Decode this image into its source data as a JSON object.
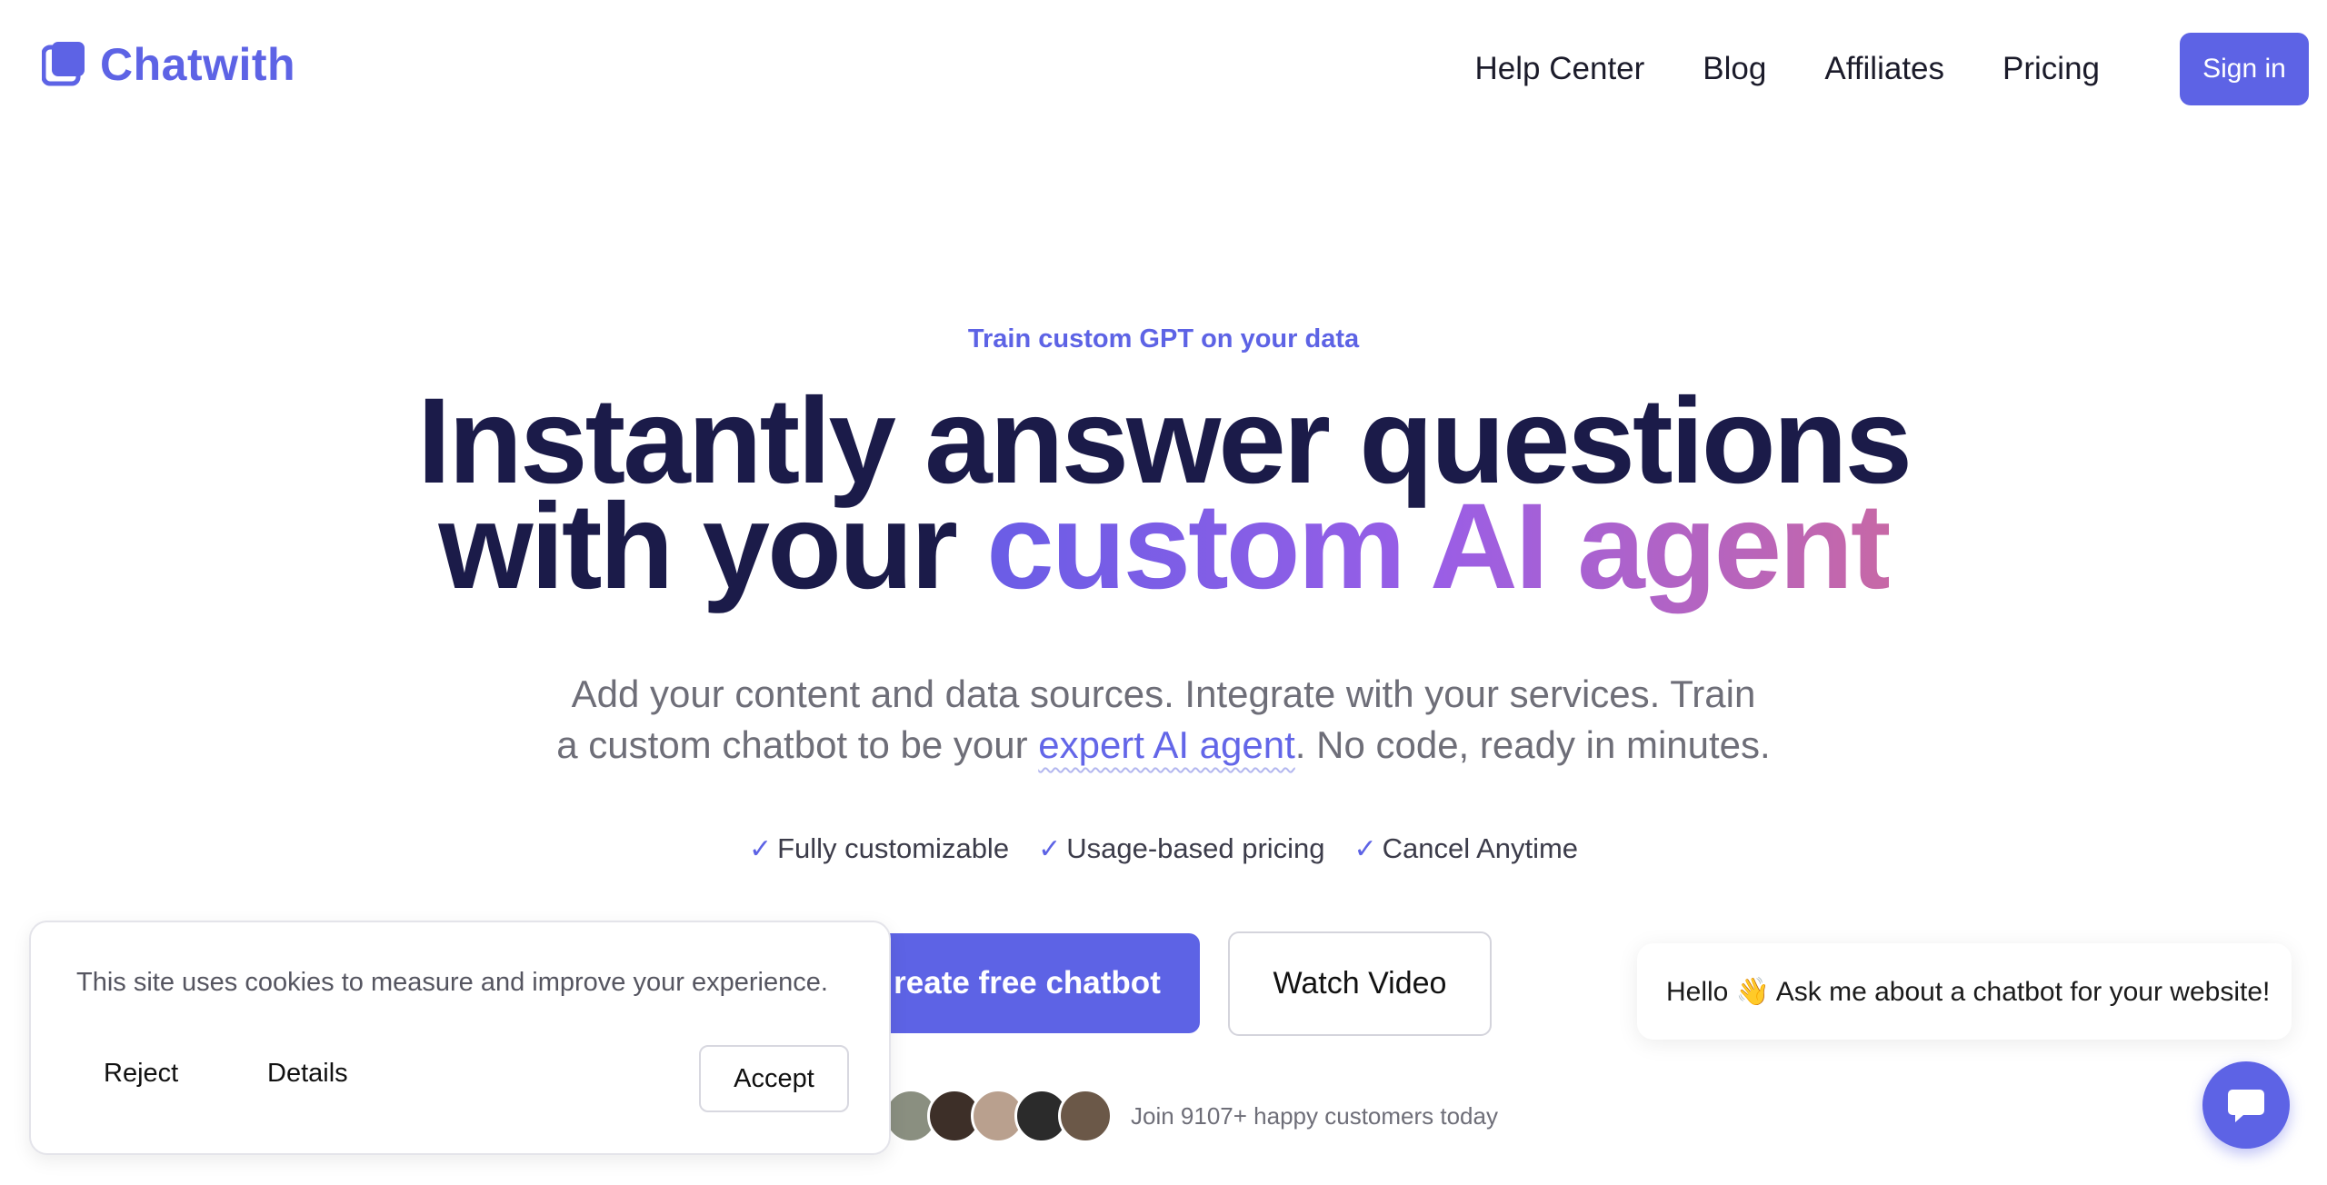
{
  "colors": {
    "brand": "#5d63e5",
    "heading": "#1b1b49",
    "body_text": "#6e6e78"
  },
  "header": {
    "logo_text": "Chatwith",
    "nav": [
      "Help Center",
      "Blog",
      "Affiliates",
      "Pricing"
    ],
    "signin_label": "Sign in"
  },
  "hero": {
    "eyebrow": "Train custom GPT on your data",
    "headline_line1": "Instantly answer questions",
    "headline_line2_plain": "with your ",
    "headline_line2_highlight": "custom AI agent",
    "subhead_part1": "Add your content and data sources. Integrate with your services. Train",
    "subhead_part2": "a custom chatbot to be your ",
    "subhead_link": "expert AI agent",
    "subhead_part3": ". No code, ready in minutes.",
    "features": [
      "Fully customizable",
      "Usage-based pricing",
      "Cancel Anytime"
    ],
    "cta_primary": "reate free chatbot",
    "cta_secondary": "Watch Video",
    "customers_text": "Join 9107+ happy customers today"
  },
  "cookie_banner": {
    "message": "This site uses cookies to measure and improve your experience.",
    "reject_label": "Reject",
    "details_label": "Details",
    "accept_label": "Accept"
  },
  "chat_widget": {
    "greeting": "Hello 👋 Ask me about a chatbot for your website!",
    "launcher_icon": "chat-bubble-icon"
  }
}
